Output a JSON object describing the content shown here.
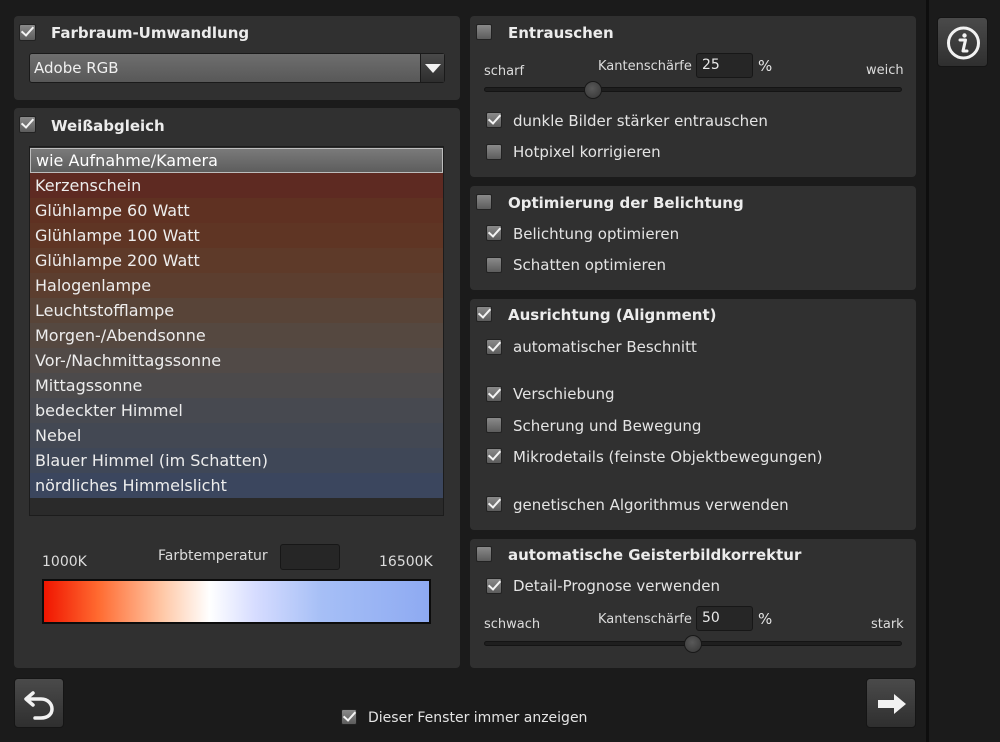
{
  "colorspace": {
    "title": "Farbraum-Umwandlung",
    "checked": true,
    "selected": "Adobe RGB"
  },
  "whitebalance": {
    "title": "Weißabgleich",
    "checked": true,
    "items": [
      {
        "label": "wie Aufnahme/Kamera",
        "color": "#6a6a6a"
      },
      {
        "label": "Kerzenschein",
        "color": "#5e2a22"
      },
      {
        "label": "Glühlampe 60 Watt",
        "color": "#5f3122"
      },
      {
        "label": "Glühlampe 100 Watt",
        "color": "#5f3524"
      },
      {
        "label": "Glühlampe 200 Watt",
        "color": "#5e3a29"
      },
      {
        "label": "Halogenlampe",
        "color": "#5c3e2f"
      },
      {
        "label": "Leuchtstofflampe",
        "color": "#584438"
      },
      {
        "label": "Morgen-/Abendsonne",
        "color": "#554840"
      },
      {
        "label": "Vor-/Nachmittagssonne",
        "color": "#514a47"
      },
      {
        "label": "Mittagssonne",
        "color": "#4c4a4b"
      },
      {
        "label": "bedeckter Himmel",
        "color": "#474950"
      },
      {
        "label": "Nebel",
        "color": "#434853"
      },
      {
        "label": "Blauer Himmel (im Schatten)",
        "color": "#3f4757"
      },
      {
        "label": "nördliches Himmelslicht",
        "color": "#3b465e"
      }
    ],
    "temp_min": "1000K",
    "temp_label": "Farbtemperatur",
    "temp_value": "",
    "temp_max": "16500K"
  },
  "denoise": {
    "title": "Entrauschen",
    "checked": false,
    "left": "scharf",
    "label": "Kantenschärfe",
    "value": "25",
    "unit": "%",
    "right": "weich",
    "slider_fraction": 0.25,
    "options": [
      {
        "label": "dunkle Bilder stärker entrauschen",
        "checked": true
      },
      {
        "label": "Hotpixel korrigieren",
        "checked": false
      }
    ]
  },
  "exposure": {
    "title": "Optimierung der Belichtung",
    "checked": false,
    "options": [
      {
        "label": "Belichtung optimieren",
        "checked": true
      },
      {
        "label": "Schatten optimieren",
        "checked": false
      }
    ]
  },
  "alignment": {
    "title": "Ausrichtung (Alignment)",
    "checked": true,
    "options": [
      {
        "label": "automatischer Beschnitt",
        "checked": true
      },
      {
        "label": "Verschiebung",
        "checked": true
      },
      {
        "label": "Scherung und Bewegung",
        "checked": false
      },
      {
        "label": "Mikrodetails (feinste Objektbewegungen)",
        "checked": true
      },
      {
        "label": "genetischen Algorithmus verwenden",
        "checked": true
      }
    ]
  },
  "ghost": {
    "title": "automatische Geisterbildkorrektur",
    "checked": false,
    "option": {
      "label": "Detail-Prognose verwenden",
      "checked": true
    },
    "left": "schwach",
    "label": "Kantenschärfe",
    "value": "50",
    "unit": "%",
    "right": "stark",
    "slider_fraction": 0.5
  },
  "footer": {
    "always_show": "Dieser Fenster immer anzeigen",
    "always_show_checked": true
  },
  "icons": {
    "info": "info-icon",
    "undo": "undo-arrow-icon",
    "next": "right-arrow-icon",
    "dropdown": "chevron-down-icon"
  }
}
